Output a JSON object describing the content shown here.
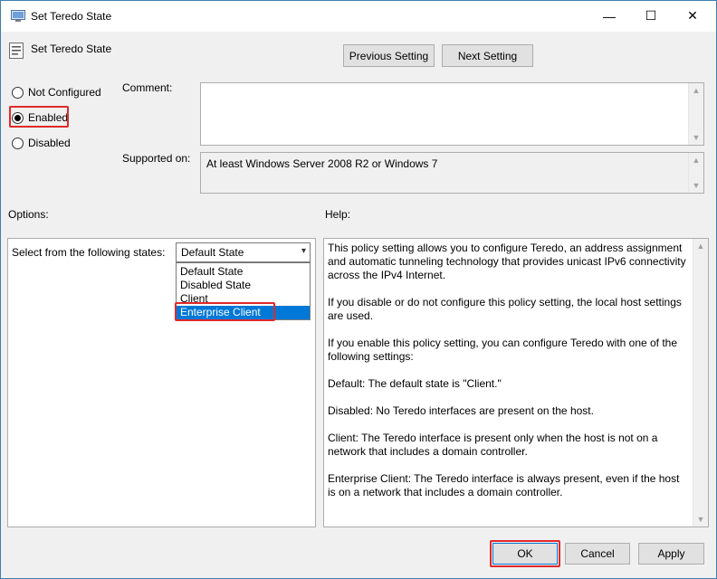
{
  "window": {
    "title": "Set Teredo State",
    "minimize_glyph": "—",
    "maximize_glyph": "☐",
    "close_glyph": "✕"
  },
  "header": {
    "policy_name": "Set Teredo State",
    "previous_setting": "Previous Setting",
    "next_setting": "Next Setting"
  },
  "state": {
    "options": [
      {
        "label": "Not Configured",
        "checked": false
      },
      {
        "label": "Enabled",
        "checked": true
      },
      {
        "label": "Disabled",
        "checked": false
      }
    ]
  },
  "comment": {
    "label": "Comment:",
    "value": ""
  },
  "supported": {
    "label": "Supported on:",
    "value": "At least Windows Server 2008 R2 or Windows 7"
  },
  "options_section": {
    "label": "Options:",
    "select_label": "Select from the following states:",
    "selected_value": "Default State",
    "dropdown_items": [
      "Default State",
      "Disabled State",
      "Client",
      "Enterprise Client"
    ],
    "highlighted_item": "Enterprise Client"
  },
  "help": {
    "label": "Help:",
    "paragraphs": [
      "This policy setting allows you to configure Teredo, an address assignment and automatic tunneling technology that provides unicast IPv6 connectivity across the IPv4 Internet.",
      "If you disable or do not configure this policy setting, the local host settings are used.",
      "If you enable this policy setting, you can configure Teredo with one of the following settings:",
      "Default: The default state is \"Client.\"",
      "Disabled: No Teredo interfaces are present on the host.",
      "Client: The Teredo interface is present only when the host is not on a network that includes a domain controller.",
      "Enterprise Client: The Teredo interface is always present, even if the host is on a network that includes a domain controller."
    ]
  },
  "footer": {
    "ok": "OK",
    "cancel": "Cancel",
    "apply": "Apply"
  },
  "colors": {
    "highlight_red": "#e02a2a",
    "selection_blue": "#0078d7"
  }
}
